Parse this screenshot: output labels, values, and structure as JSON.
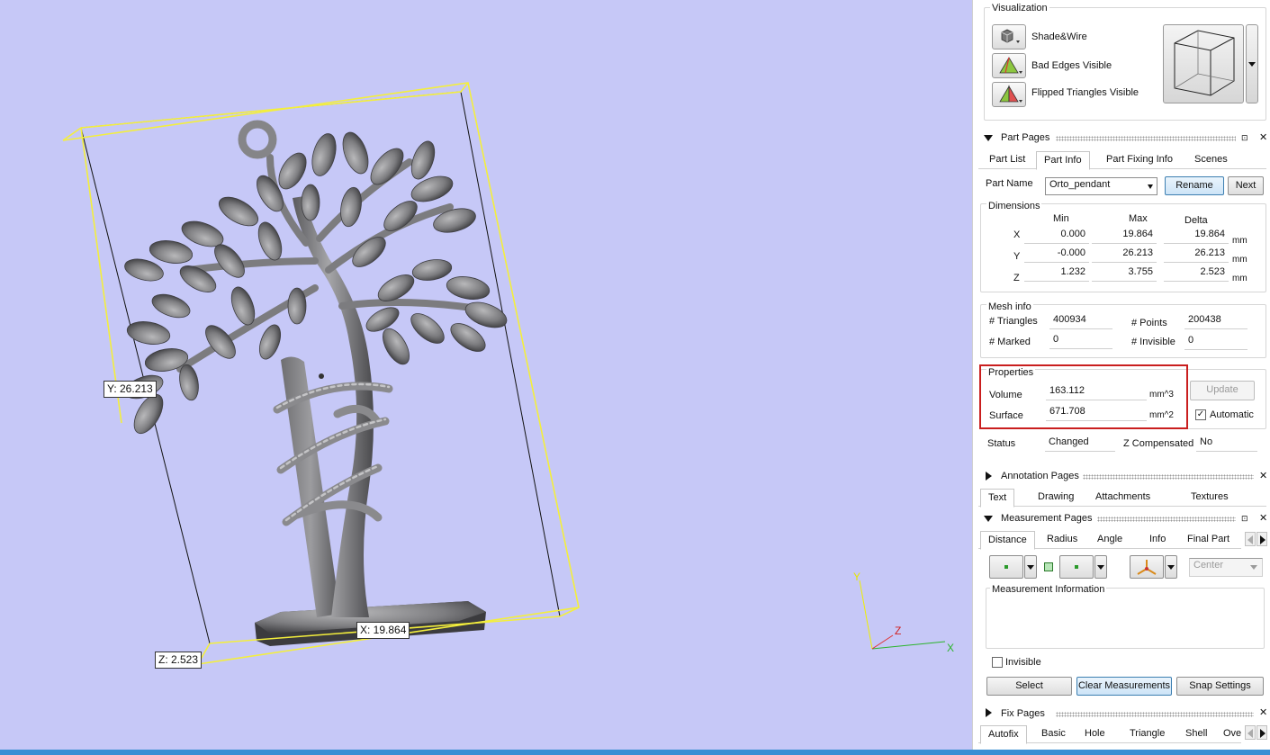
{
  "viewport": {
    "labels": {
      "y_dim": "Y: 26.213",
      "x_dim": "X: 19.864",
      "z_dim": "Z: 2.523"
    },
    "axes": {
      "x": "X",
      "y": "Y",
      "z": "Z"
    },
    "colors": {
      "background": "#c6c8f7",
      "bbox": "#f4ef3c",
      "model": "#7a7a7c"
    }
  },
  "visualization": {
    "title": "Visualization",
    "options": [
      {
        "label": "Shade&Wire",
        "icon": "cube-shade-icon"
      },
      {
        "label": "Bad Edges Visible",
        "icon": "bad-edges-icon"
      },
      {
        "label": "Flipped Triangles Visible",
        "icon": "flipped-triangles-icon"
      }
    ]
  },
  "part_pages": {
    "title": "Part Pages",
    "tabs": [
      "Part List",
      "Part Info",
      "Part Fixing Info",
      "Scenes"
    ],
    "active_tab": "Part Info",
    "part_name_label": "Part Name",
    "part_name_value": "Orto_pendant",
    "rename_label": "Rename",
    "next_label": "Next",
    "dimensions": {
      "title": "Dimensions",
      "headers": [
        "Min",
        "Max",
        "Delta"
      ],
      "rows": [
        {
          "axis": "X",
          "min": "0.000",
          "max": "19.864",
          "delta": "19.864",
          "unit": "mm"
        },
        {
          "axis": "Y",
          "min": "-0.000",
          "max": "26.213",
          "delta": "26.213",
          "unit": "mm"
        },
        {
          "axis": "Z",
          "min": "1.232",
          "max": "3.755",
          "delta": "2.523",
          "unit": "mm"
        }
      ]
    },
    "mesh_info": {
      "title": "Mesh info",
      "triangles_label": "# Triangles",
      "triangles_value": "400934",
      "points_label": "# Points",
      "points_value": "200438",
      "marked_label": "# Marked",
      "marked_value": "0",
      "invisible_label": "# Invisible",
      "invisible_value": "0"
    },
    "properties": {
      "title": "Properties",
      "volume_label": "Volume",
      "volume_value": "163.112",
      "volume_unit": "mm^3",
      "surface_label": "Surface",
      "surface_value": "671.708",
      "surface_unit": "mm^2",
      "update_label": "Update",
      "automatic_label": "Automatic"
    },
    "status_label": "Status",
    "status_value": "Changed",
    "zcomp_label": "Z Compensated",
    "zcomp_value": "No"
  },
  "annotation_pages": {
    "title": "Annotation Pages",
    "tabs": [
      "Text",
      "Drawing",
      "Attachments",
      "Textures"
    ],
    "active_tab": "Text"
  },
  "measurement_pages": {
    "title": "Measurement Pages",
    "tabs": [
      "Distance",
      "Radius",
      "Angle",
      "Info",
      "Final Part"
    ],
    "active_tab": "Distance",
    "center_placeholder": "Center",
    "info_title": "Measurement Information",
    "invisible_label": "Invisible",
    "select_label": "Select",
    "clear_label": "Clear Measurements",
    "snap_label": "Snap Settings"
  },
  "fix_pages": {
    "title": "Fix Pages",
    "tabs": [
      "Autofix",
      "Basic",
      "Hole",
      "Triangle",
      "Shell",
      "Over"
    ],
    "active_tab": "Autofix"
  }
}
